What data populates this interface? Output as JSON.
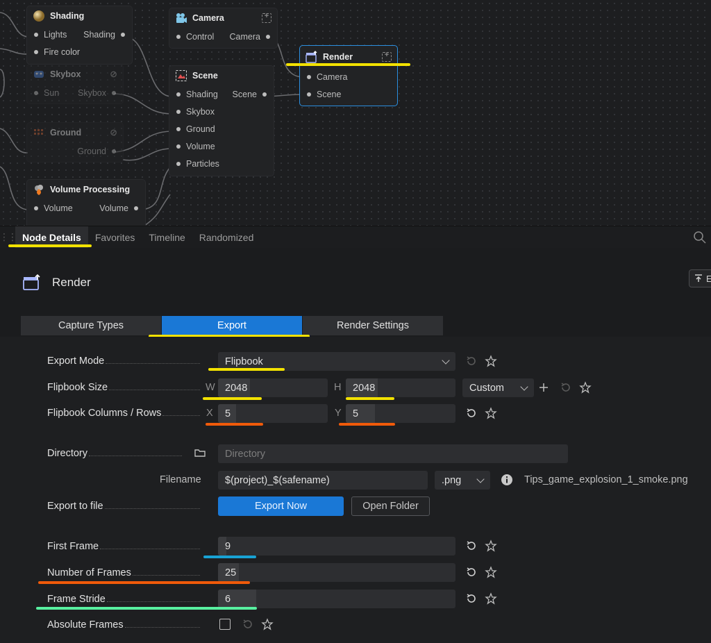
{
  "graph": {
    "nodes": {
      "shading": {
        "title": "Shading",
        "rows": [
          {
            "left": "Lights",
            "right": "Shading"
          },
          {
            "left": "Fire color",
            "right": ""
          }
        ]
      },
      "skybox": {
        "title": "Skybox",
        "rows": [
          {
            "left": "Sun",
            "right": "Skybox"
          }
        ]
      },
      "ground": {
        "title": "Ground",
        "rows": [
          {
            "left": "",
            "right": "Ground"
          }
        ]
      },
      "volume_processing": {
        "title": "Volume Processing",
        "rows": [
          {
            "left": "Volume",
            "right": "Volume"
          }
        ]
      },
      "camera": {
        "title": "Camera",
        "rows": [
          {
            "left": "Control",
            "right": "Camera"
          }
        ]
      },
      "scene": {
        "title": "Scene",
        "rows": [
          {
            "left": "Shading",
            "right": "Scene"
          },
          {
            "left": "Skybox"
          },
          {
            "left": "Ground"
          },
          {
            "left": "Volume"
          },
          {
            "left": "Particles"
          }
        ]
      },
      "render": {
        "title": "Render",
        "rows": [
          {
            "left": "Camera"
          },
          {
            "left": "Scene"
          }
        ]
      }
    }
  },
  "panel_tabs": [
    "Node Details",
    "Favorites",
    "Timeline",
    "Randomized"
  ],
  "panel_tabs_active": "Node Details",
  "node_details": {
    "title": "Render",
    "edge_button_label": "E",
    "subtabs": [
      "Capture Types",
      "Export",
      "Render Settings"
    ],
    "subtab_active": "Export",
    "props": {
      "export_mode": {
        "label": "Export Mode",
        "value": "Flipbook"
      },
      "flipbook_size": {
        "label": "Flipbook Size",
        "w_axis": "W",
        "w": "2048",
        "h_axis": "H",
        "h": "2048",
        "preset": "Custom"
      },
      "flipbook_cols_rows": {
        "label": "Flipbook Columns / Rows",
        "x_axis": "X",
        "x": "5",
        "y_axis": "Y",
        "y": "5"
      },
      "directory": {
        "label": "Directory",
        "placeholder": "Directory"
      },
      "filename": {
        "label": "Filename",
        "value": "$(project)_$(safename)",
        "ext": ".png",
        "preview": "Tips_game_explosion_1_smoke.png"
      },
      "export_to_file": {
        "label": "Export to file",
        "primary": "Export Now",
        "secondary": "Open Folder"
      },
      "first_frame": {
        "label": "First Frame",
        "value": "9"
      },
      "number_of_frames": {
        "label": "Number of Frames",
        "value": "25"
      },
      "frame_stride": {
        "label": "Frame Stride",
        "value": "6"
      },
      "absolute_frames": {
        "label": "Absolute Frames",
        "checked": false
      }
    }
  },
  "colors": {
    "accent": "#1a78d6",
    "selected_border": "#2b8fe0",
    "mark_yellow": "#f2e100",
    "mark_orange": "#f05a0a",
    "mark_blue": "#18a2d4",
    "mark_green": "#58f0a0"
  },
  "icons": [
    "shading-sphere-icon",
    "skybox-icon",
    "ground-icon",
    "volume-fire-icon",
    "camera-icon",
    "scene-icon",
    "render-clapper-icon",
    "search-icon",
    "folder-icon",
    "info-icon",
    "reset-icon",
    "star-icon",
    "plus-icon"
  ]
}
